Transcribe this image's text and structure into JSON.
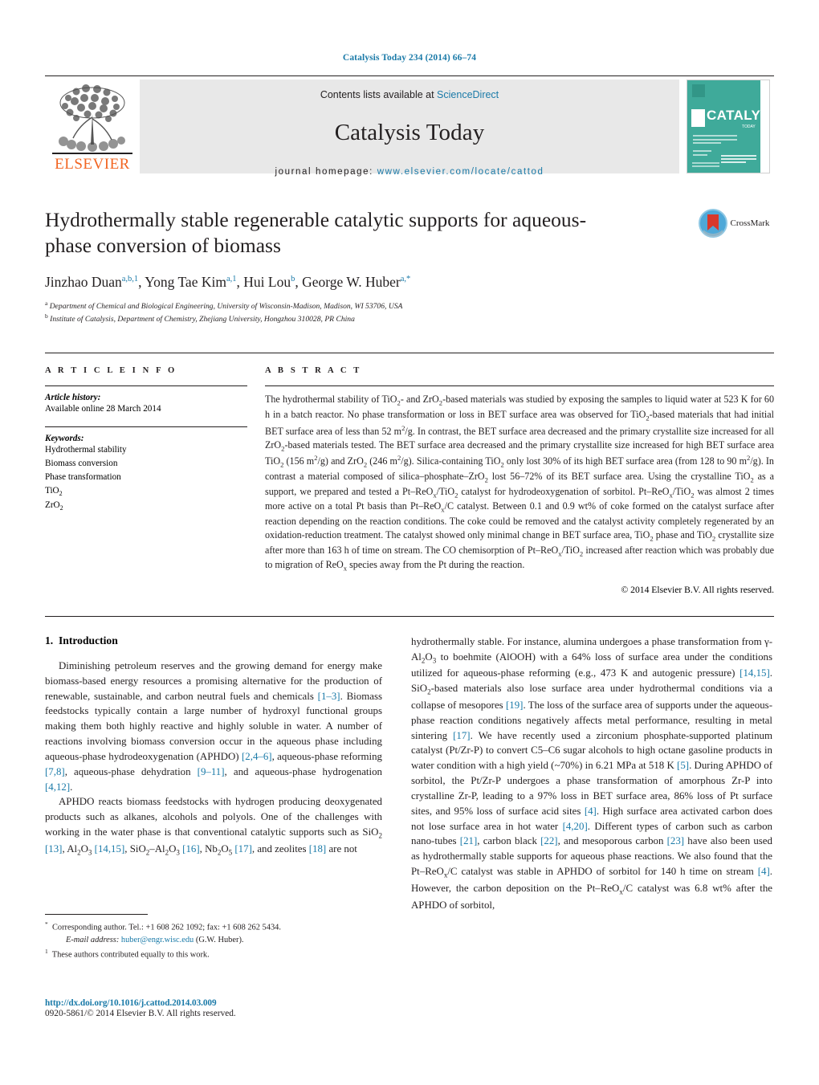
{
  "running_head": "Catalysis Today 234 (2014) 66–74",
  "masthead": {
    "contents_prefix": "Contents lists available at ",
    "sciencedirect": "ScienceDirect",
    "journal_title": "Catalysis Today",
    "homepage_prefix": "journal homepage: ",
    "homepage_url": "www.elsevier.com/locate/cattod",
    "publisher": "ELSEVIER",
    "cover_word": "CATALYSIS",
    "cover_sub": "TODAY"
  },
  "article": {
    "title": "Hydrothermally stable regenerable catalytic supports for aqueous-phase conversion of biomass",
    "authors_html": "Jinzhao Duan<sup>a,b,1</sup>, Yong Tae Kim<sup>a,1</sup>, Hui Lou<sup>b</sup>, George W. Huber<sup>a,*</sup>",
    "affiliation_a": "Department of Chemical and Biological Engineering, University of Wisconsin-Madison, Madison, WI 53706, USA",
    "affiliation_b": "Institute of Catalysis, Department of Chemistry, Zhejiang University, Hongzhou 310028, PR China",
    "crossmark_label": "CrossMark"
  },
  "article_info": {
    "heading": "A R T I C L E   I N F O",
    "history_label": "Article history:",
    "history_value": "Available online 28 March 2014",
    "keywords_label": "Keywords:",
    "keywords": [
      "Hydrothermal stability",
      "Biomass conversion",
      "Phase transformation",
      "TiO2",
      "ZrO2"
    ]
  },
  "abstract": {
    "heading": "A B S T R A C T",
    "text": "The hydrothermal stability of TiO2- and ZrO2-based materials was studied by exposing the samples to liquid water at 523 K for 60 h in a batch reactor. No phase transformation or loss in BET surface area was observed for TiO2-based materials that had initial BET surface area of less than 52 m2/g. In contrast, the BET surface area decreased and the primary crystallite size increased for all ZrO2-based materials tested. The BET surface area decreased and the primary crystallite size increased for high BET surface area TiO2 (156 m2/g) and ZrO2 (246 m2/g). Silica-containing TiO2 only lost 30% of its high BET surface area (from 128 to 90 m2/g). In contrast a material composed of silica–phosphate–ZrO2 lost 56–72% of its BET surface area. Using the crystalline TiO2 as a support, we prepared and tested a Pt–ReOx/TiO2 catalyst for hydrodeoxygenation of sorbitol. Pt–ReOx/TiO2 was almost 2 times more active on a total Pt basis than Pt–ReOx/C catalyst. Between 0.1 and 0.9 wt% of coke formed on the catalyst surface after reaction depending on the reaction conditions. The coke could be removed and the catalyst activity completely regenerated by an oxidation-reduction treatment. The catalyst showed only minimal change in BET surface area, TiO2 phase and TiO2 crystallite size after more than 163 h of time on stream. The CO chemisorption of Pt–ReOx/TiO2 increased after reaction which was probably due to migration of ReOx species away from the Pt during the reaction.",
    "copyright": "© 2014 Elsevier B.V. All rights reserved."
  },
  "introduction": {
    "section_number": "1.",
    "section_title": "Introduction",
    "para1": "Diminishing petroleum reserves and the growing demand for energy make biomass-based energy resources a promising alternative for the production of renewable, sustainable, and carbon neutral fuels and chemicals [1–3]. Biomass feedstocks typically contain a large number of hydroxyl functional groups making them both highly reactive and highly soluble in water. A number of reactions involving biomass conversion occur in the aqueous phase including aqueous-phase hydrodeoxygenation (APHDO) [2,4–6], aqueous-phase reforming [7,8], aqueous-phase dehydration [9–11], and aqueous-phase hydrogenation [4,12].",
    "para2": "APHDO reacts biomass feedstocks with hydrogen producing deoxygenated products such as alkanes, alcohols and polyols. One of the challenges with working in the water phase is that conventional catalytic supports such as SiO2 [13], Al2O3 [14,15], SiO2–Al2O3 [16], Nb2O5 [17], and zeolites [18] are not hydrothermally stable. For instance, alumina undergoes a phase transformation from γ-Al2O3 to boehmite (AlOOH) with a 64% loss of surface area under the conditions utilized for aqueous-phase reforming (e.g., 473 K and autogenic pressure) [14,15]. SiO2-based materials also lose surface area under hydrothermal conditions via a collapse of mesopores [19]. The loss of the surface area of supports under the aqueous-phase reaction conditions negatively affects metal performance, resulting in metal sintering [17]. We have recently used a zirconium phosphate-supported platinum catalyst (Pt/Zr-P) to convert C5–C6 sugar alcohols to high octane gasoline products in water condition with a high yield (~70%) in 6.21 MPa at 518 K [5]. During APHDO of sorbitol, the Pt/Zr-P undergoes a phase transformation of amorphous Zr-P into crystalline Zr-P, leading to a 97% loss in BET surface area, 86% loss of Pt surface sites, and 95% loss of surface acid sites [4]. High surface area activated carbon does not lose surface area in hot water [4,20]. Different types of carbon such as carbon nano-tubes [21], carbon black [22], and mesoporous carbon [23] have also been used as hydrothermally stable supports for aqueous phase reactions. We also found that the Pt–ReOx/C catalyst was stable in APHDO of sorbitol for 140 h time on stream [4]. However, the carbon deposition on the Pt–ReOx/C catalyst was 6.8 wt% after the APHDO of sorbitol,"
  },
  "footnotes": {
    "corresponding": "Corresponding author. Tel.: +1 608 262 1092; fax: +1 608 262 5434.",
    "email_label": "E-mail address:",
    "email": "huber@engr.wisc.edu",
    "email_suffix": "(G.W. Huber).",
    "equal_contrib": "These authors contributed equally to this work."
  },
  "doi_block": {
    "doi": "http://dx.doi.org/10.1016/j.cattod.2014.03.009",
    "issn": "0920-5861/© 2014 Elsevier B.V. All rights reserved."
  },
  "colors": {
    "link": "#1a7aa8",
    "elsevier_orange": "#f26522",
    "cover_teal": "#3faa9a",
    "masthead_grey": "#e8e8e8"
  }
}
